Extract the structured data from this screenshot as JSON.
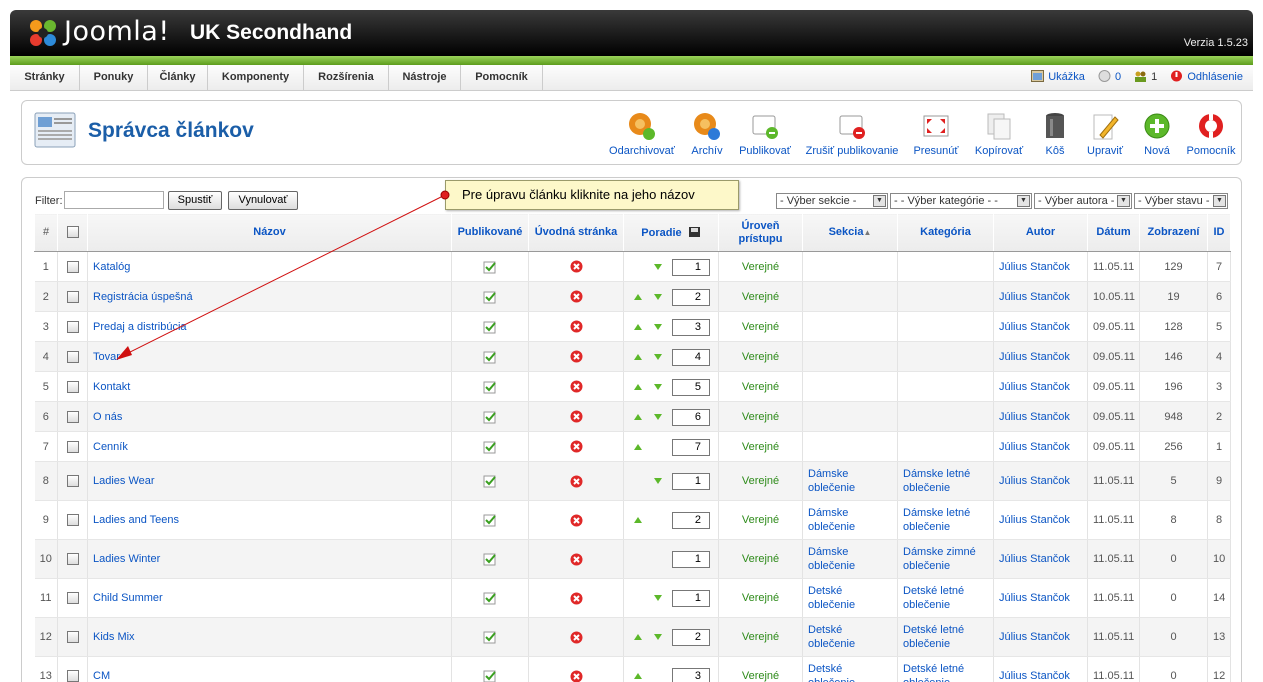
{
  "header": {
    "brand": "Joomla!",
    "site_name": "UK Secondhand",
    "version": "Verzia 1.5.23"
  },
  "menu": {
    "items": [
      "Stránky",
      "Ponuky",
      "Články",
      "Komponenty",
      "Rozšírenia",
      "Nástroje",
      "Pomocník"
    ]
  },
  "status": {
    "preview": "Ukážka",
    "messages": "0",
    "users": "1",
    "logout": "Odhlásenie"
  },
  "page": {
    "title": "Správca článkov"
  },
  "toolbar": {
    "buttons": [
      "Odarchivovať",
      "Archív",
      "Publikovať",
      "Zrušiť publikovanie",
      "Presunúť",
      "Kopírovať",
      "Kôš",
      "Upraviť",
      "Nová",
      "Pomocník"
    ]
  },
  "filter": {
    "label": "Filter:",
    "value": "",
    "go_label": "Spustiť",
    "reset_label": "Vynulovať",
    "section_select": "- Výber sekcie -",
    "category_select": "- - Výber kategórie - -",
    "author_select": "- Výber autora -",
    "state_select": "- Výber stavu -"
  },
  "callout": {
    "text": "Pre úpravu článku kliknite na jeho názov"
  },
  "table": {
    "headers": {
      "num": "#",
      "title": "Názov",
      "published": "Publikované",
      "frontpage": "Úvodná stránka",
      "order": "Poradie",
      "access": "Úroveň prístupu",
      "section": "Sekcia",
      "category": "Kategória",
      "author": "Autor",
      "date": "Dátum",
      "hits": "Zobrazení",
      "id": "ID"
    },
    "rows": [
      {
        "num": "1",
        "title": "Katalóg",
        "up": false,
        "down": true,
        "order": "1",
        "access": "Verejné",
        "section": "",
        "category": "",
        "author": "Július Stančok",
        "date": "11.05.11",
        "hits": "129",
        "id": "7"
      },
      {
        "num": "2",
        "title": "Registrácia úspešná",
        "up": true,
        "down": true,
        "order": "2",
        "access": "Verejné",
        "section": "",
        "category": "",
        "author": "Július Stančok",
        "date": "10.05.11",
        "hits": "19",
        "id": "6"
      },
      {
        "num": "3",
        "title": "Predaj a distribúcia",
        "up": true,
        "down": true,
        "order": "3",
        "access": "Verejné",
        "section": "",
        "category": "",
        "author": "Július Stančok",
        "date": "09.05.11",
        "hits": "128",
        "id": "5"
      },
      {
        "num": "4",
        "title": "Tovar",
        "up": true,
        "down": true,
        "order": "4",
        "access": "Verejné",
        "section": "",
        "category": "",
        "author": "Július Stančok",
        "date": "09.05.11",
        "hits": "146",
        "id": "4"
      },
      {
        "num": "5",
        "title": "Kontakt",
        "up": true,
        "down": true,
        "order": "5",
        "access": "Verejné",
        "section": "",
        "category": "",
        "author": "Július Stančok",
        "date": "09.05.11",
        "hits": "196",
        "id": "3"
      },
      {
        "num": "6",
        "title": "O nás",
        "up": true,
        "down": true,
        "order": "6",
        "access": "Verejné",
        "section": "",
        "category": "",
        "author": "Július Stančok",
        "date": "09.05.11",
        "hits": "948",
        "id": "2"
      },
      {
        "num": "7",
        "title": "Cenník",
        "up": true,
        "down": false,
        "order": "7",
        "access": "Verejné",
        "section": "",
        "category": "",
        "author": "Július Stančok",
        "date": "09.05.11",
        "hits": "256",
        "id": "1"
      },
      {
        "num": "8",
        "title": "Ladies Wear",
        "up": false,
        "down": true,
        "order": "1",
        "access": "Verejné",
        "section": "Dámske oblečenie",
        "category": "Dámske letné oblečenie",
        "author": "Július Stančok",
        "date": "11.05.11",
        "hits": "5",
        "id": "9"
      },
      {
        "num": "9",
        "title": "Ladies and Teens",
        "up": true,
        "down": false,
        "order": "2",
        "access": "Verejné",
        "section": "Dámske oblečenie",
        "category": "Dámske letné oblečenie",
        "author": "Július Stančok",
        "date": "11.05.11",
        "hits": "8",
        "id": "8"
      },
      {
        "num": "10",
        "title": "Ladies Winter",
        "up": false,
        "down": false,
        "order": "1",
        "access": "Verejné",
        "section": "Dámske oblečenie",
        "category": "Dámske zimné oblečenie",
        "author": "Július Stančok",
        "date": "11.05.11",
        "hits": "0",
        "id": "10"
      },
      {
        "num": "11",
        "title": "Child Summer",
        "up": false,
        "down": true,
        "order": "1",
        "access": "Verejné",
        "section": "Detské oblečenie",
        "category": "Detské letné oblečenie",
        "author": "Július Stančok",
        "date": "11.05.11",
        "hits": "0",
        "id": "14"
      },
      {
        "num": "12",
        "title": "Kids Mix",
        "up": true,
        "down": true,
        "order": "2",
        "access": "Verejné",
        "section": "Detské oblečenie",
        "category": "Detské letné oblečenie",
        "author": "Július Stančok",
        "date": "11.05.11",
        "hits": "0",
        "id": "13"
      },
      {
        "num": "13",
        "title": "CM",
        "up": true,
        "down": false,
        "order": "3",
        "access": "Verejné",
        "section": "Detské oblečenie",
        "category": "Detské letné oblečenie",
        "author": "Július Stančok",
        "date": "11.05.11",
        "hits": "0",
        "id": "12"
      }
    ]
  }
}
